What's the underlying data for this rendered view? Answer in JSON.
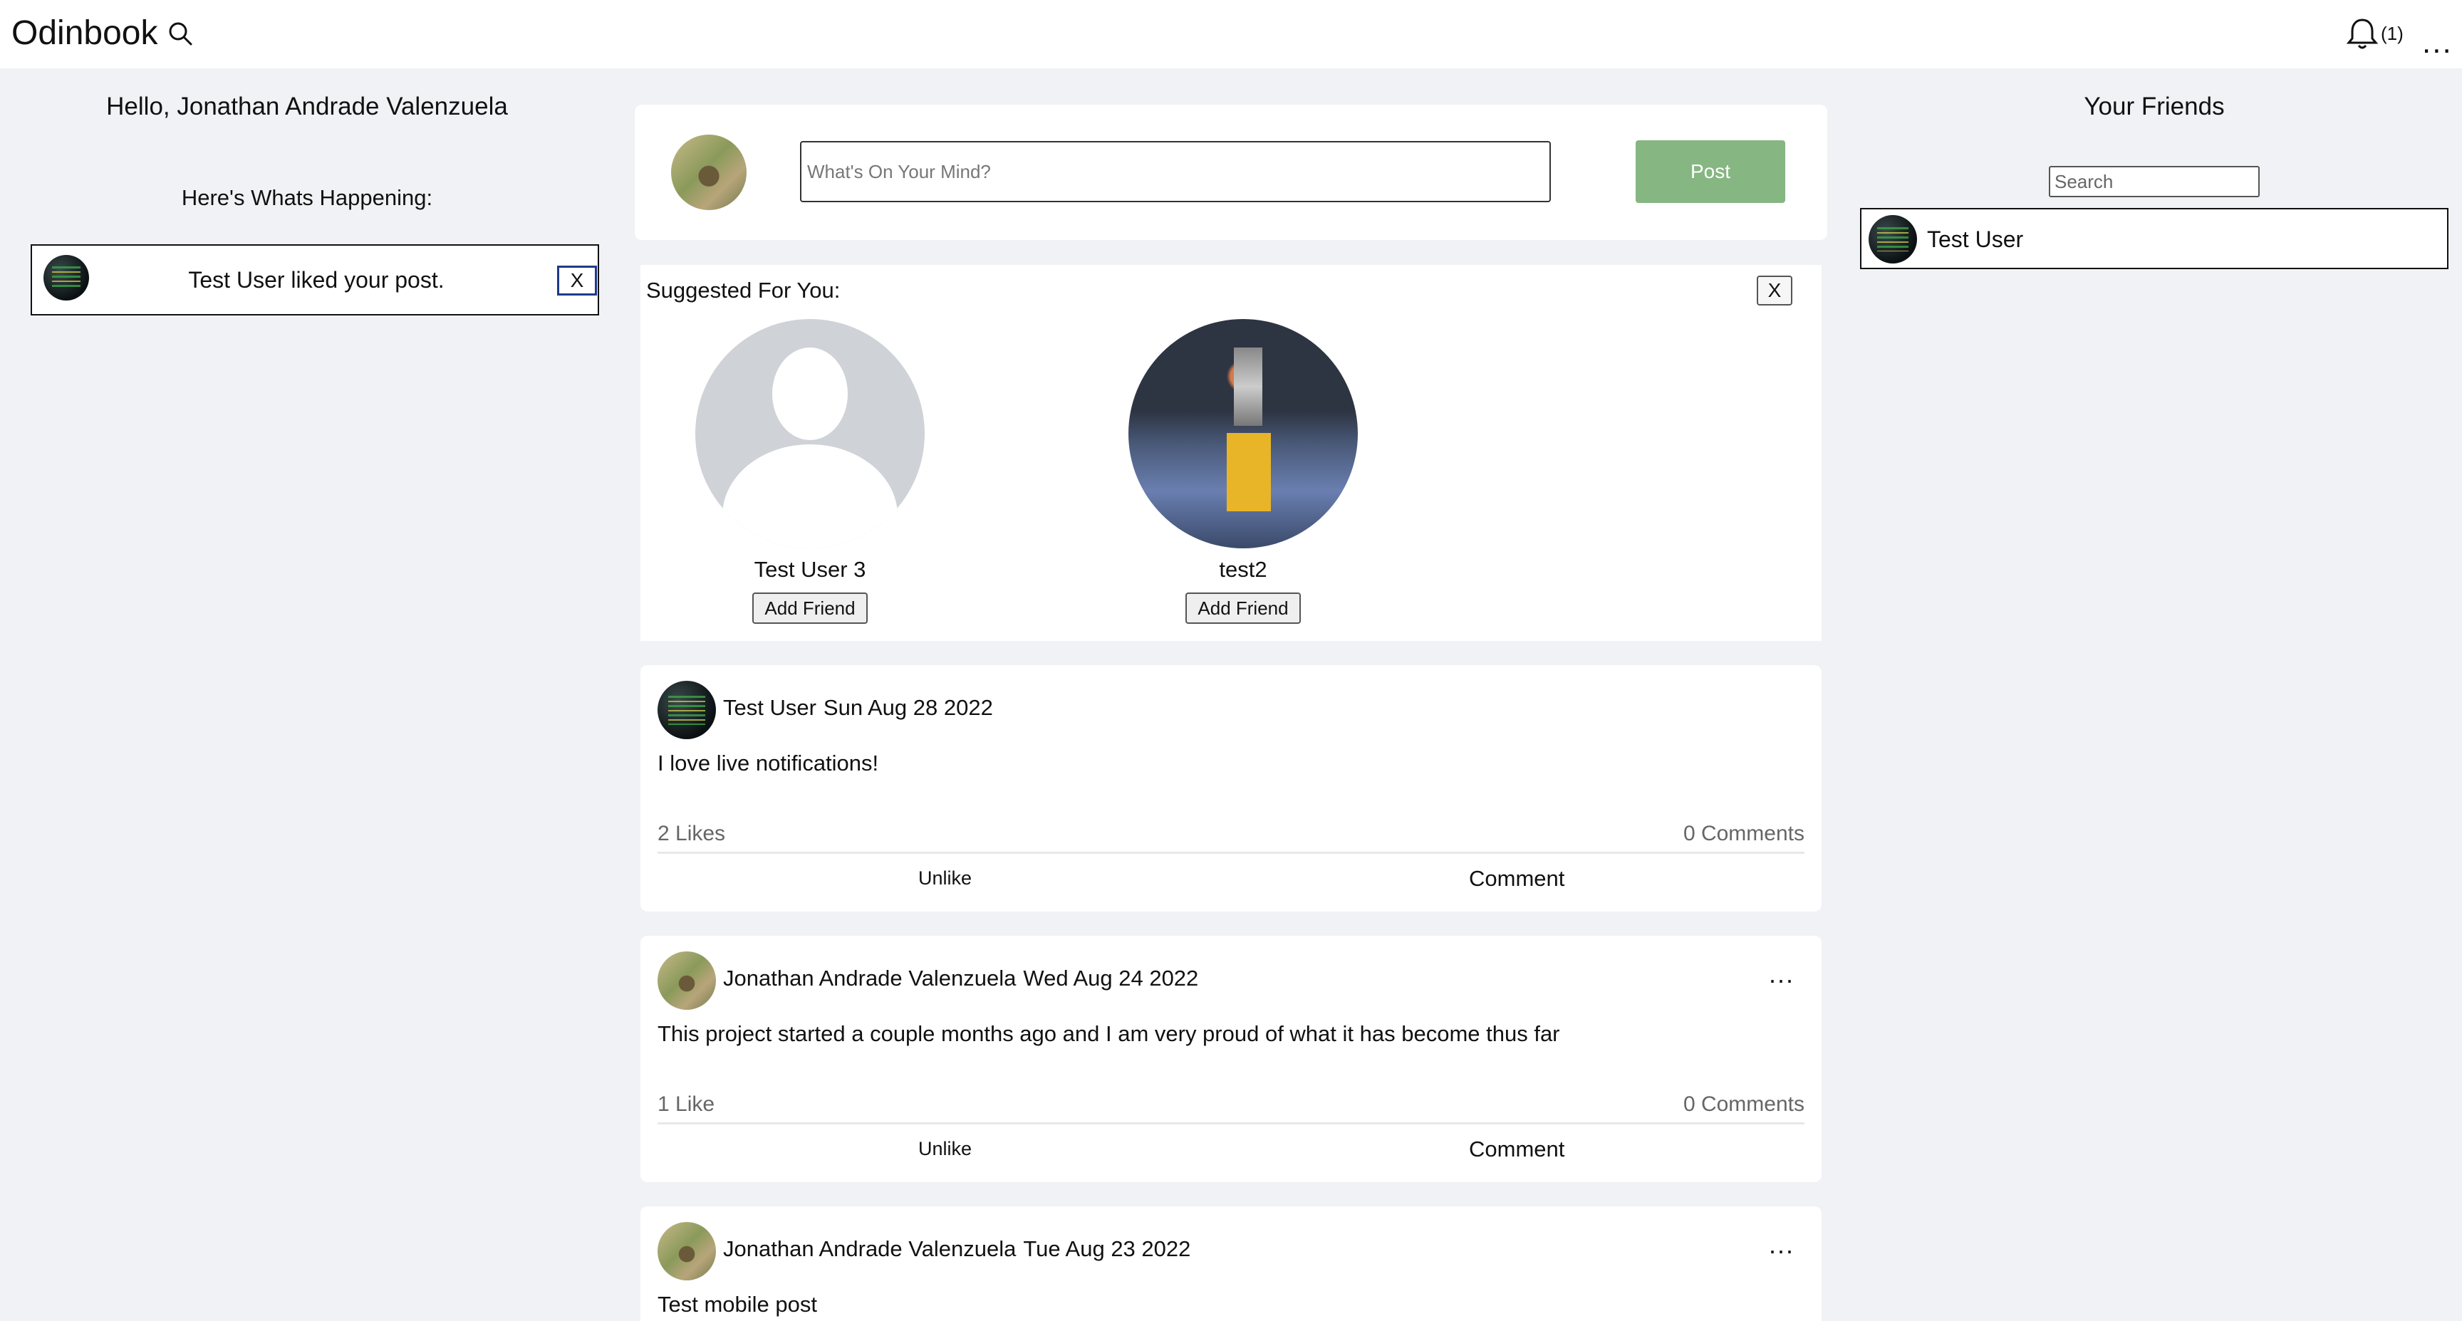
{
  "header": {
    "brand": "Odinbook",
    "notification_count": "(1)",
    "menu": "..."
  },
  "left": {
    "greeting": "Hello, Jonathan Andrade Valenzuela",
    "happening_title": "Here's Whats Happening:",
    "notifications": [
      {
        "text": "Test User liked your post.",
        "close_label": "X"
      }
    ]
  },
  "composer": {
    "placeholder": "What's On Your Mind?",
    "post_label": "Post"
  },
  "suggestions": {
    "title": "Suggested For You:",
    "close_label": "X",
    "people": [
      {
        "name": "Test User 3",
        "button": "Add Friend"
      },
      {
        "name": "test2",
        "button": "Add Friend"
      }
    ]
  },
  "posts": [
    {
      "author": "Test User",
      "date": "Sun Aug 28 2022",
      "body": "I love live notifications!",
      "likes": "2 Likes",
      "comments": "0 Comments",
      "like_action": "Unlike",
      "comment_action": "Comment"
    },
    {
      "author": "Jonathan Andrade Valenzuela",
      "date": "Wed Aug 24 2022",
      "body": "This project started a couple months ago and I am very proud of what it has become thus far",
      "likes": "1 Like",
      "comments": "0 Comments",
      "like_action": "Unlike",
      "comment_action": "Comment",
      "menu": "..."
    },
    {
      "author": "Jonathan Andrade Valenzuela",
      "date": "Tue Aug 23 2022",
      "body": "Test mobile post",
      "menu": "..."
    }
  ],
  "friends": {
    "title": "Your Friends",
    "search_placeholder": "Search",
    "list": [
      {
        "name": "Test User"
      }
    ]
  },
  "colors": {
    "background": "#f0f2f5",
    "post_button": "#86b682",
    "close_border": "#1f3a8a"
  }
}
